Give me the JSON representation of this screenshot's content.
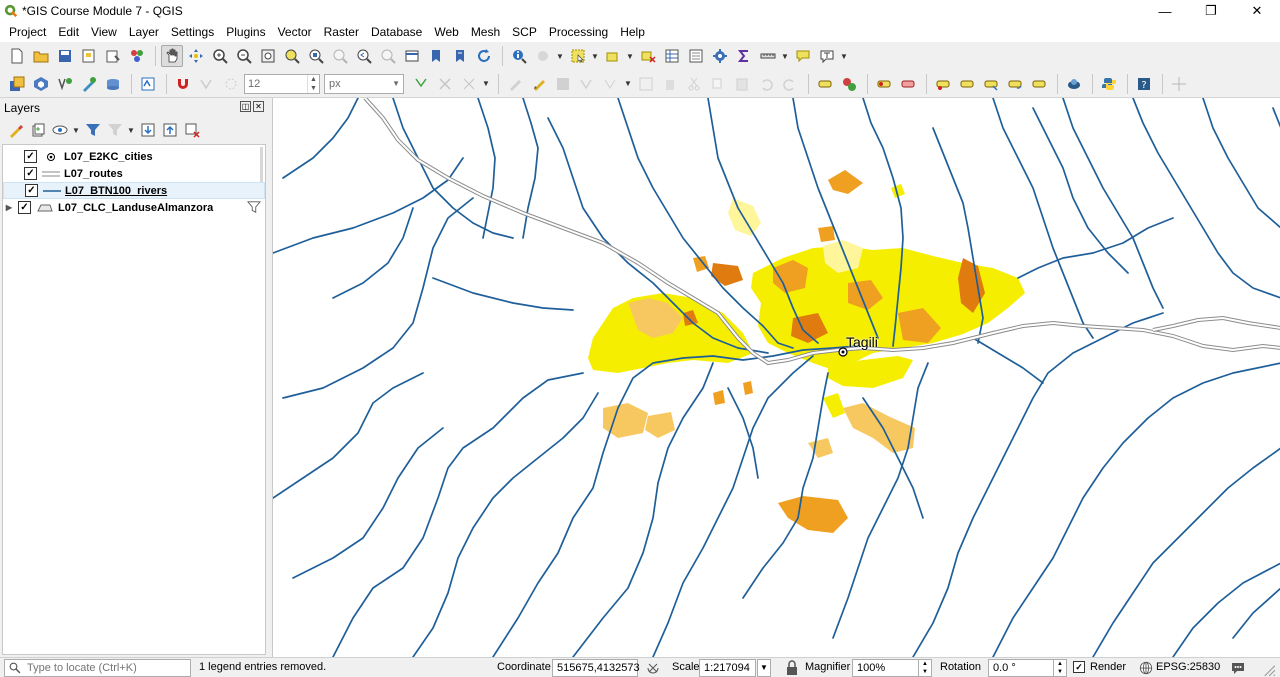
{
  "window": {
    "title": "*GIS Course Module 7 - QGIS",
    "minimize": "—",
    "maximize": "❐",
    "close": "✕"
  },
  "menu": [
    "Project",
    "Edit",
    "View",
    "Layer",
    "Settings",
    "Plugins",
    "Vector",
    "Raster",
    "Database",
    "Web",
    "Mesh",
    "SCP",
    "Processing",
    "Help"
  ],
  "toolbar2": {
    "font_size": "12",
    "unit": "px"
  },
  "layers_panel": {
    "title": "Layers",
    "layers": [
      {
        "name": "L07_E2KC_cities",
        "checked": true,
        "symbol": "point"
      },
      {
        "name": "L07_routes",
        "checked": true,
        "symbol": "double-line"
      },
      {
        "name": "L07_BTN100_rivers",
        "checked": true,
        "symbol": "line",
        "selected": true
      },
      {
        "name": "L07_CLC_LanduseAlmanzora",
        "checked": true,
        "symbol": "polygon",
        "expandable": true,
        "filtered": true
      }
    ]
  },
  "map": {
    "city_label": "Tagili",
    "colors": {
      "river": "#1f5f99",
      "route_outline": "#8c8c8c",
      "landuse_yellow": "#f5ee00",
      "landuse_lightyellow": "#fff59a",
      "landuse_orange": "#f0a020",
      "landuse_darkorange": "#e07b10",
      "landuse_paleorange": "#f8c860"
    }
  },
  "statusbar": {
    "locate_placeholder": "Type to locate (Ctrl+K)",
    "message": "1 legend entries removed.",
    "coordinate_label": "Coordinate",
    "coordinate_value": "515675,4132573",
    "scale_label": "Scale",
    "scale_value": "1:217094",
    "magnifier_label": "Magnifier",
    "magnifier_value": "100%",
    "rotation_label": "Rotation",
    "rotation_value": "0.0 °",
    "render_label": "Render",
    "crs": "EPSG:25830"
  }
}
